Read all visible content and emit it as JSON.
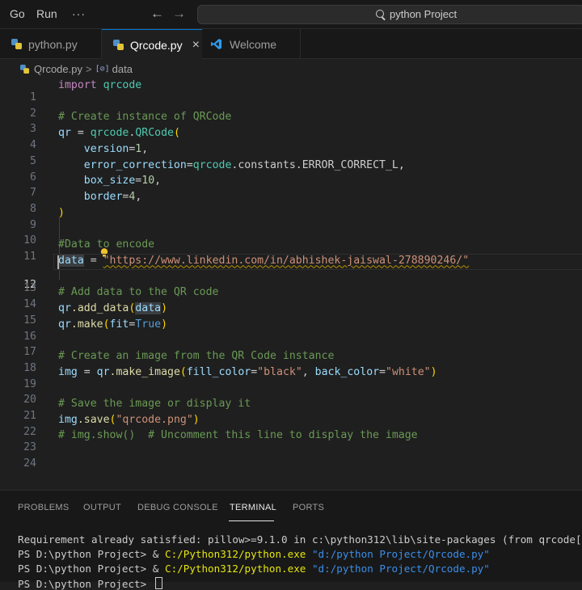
{
  "titlebar": {
    "menu_go": "Go",
    "menu_run": "Run",
    "menu_more": "···",
    "back_icon": "←",
    "forward_icon": "→",
    "search_text": "python Project"
  },
  "tabs": [
    {
      "label": "python.py",
      "icon": "python-file-icon",
      "active": false
    },
    {
      "label": "Qrcode.py",
      "icon": "python-file-icon",
      "active": true,
      "close": "×"
    },
    {
      "label": "Welcome",
      "icon": "vscode-logo-icon",
      "active": false
    }
  ],
  "breadcrumb": {
    "file": "Qrcode.py",
    "separator": ">",
    "symbol_icon": "[⊘]",
    "symbol": "data"
  },
  "editor": {
    "line_numbers": [
      "1",
      "2",
      "3",
      "4",
      "5",
      "6",
      "7",
      "8",
      "9",
      "10",
      "11",
      "12",
      "13",
      "14",
      "15",
      "16",
      "17",
      "18",
      "19",
      "20",
      "21",
      "22",
      "23",
      "24"
    ],
    "active_line": 12,
    "lines": {
      "l1": {
        "kw": "import",
        "mod": "qrcode"
      },
      "l3": {
        "comment": "# Create instance of QRCode"
      },
      "l4": {
        "var": "qr",
        "eq": " = ",
        "mod": "qrcode",
        "dot": ".",
        "cls": "QRCode",
        "open": "("
      },
      "l5": {
        "arg": "version",
        "eq": "=",
        "num": "1",
        "comma": ","
      },
      "l6": {
        "arg": "error_correction",
        "eq": "=",
        "mod": "qrcode",
        "rest": ".constants.ERROR_CORRECT_L,"
      },
      "l7": {
        "arg": "box_size",
        "eq": "=",
        "num": "10",
        "comma": ","
      },
      "l8": {
        "arg": "border",
        "eq": "=",
        "num": "4",
        "comma": ","
      },
      "l9": {
        "close": ")"
      },
      "l11": {
        "comment": "Data to encode",
        "hash": "#"
      },
      "l12": {
        "var": "data",
        "eq": " = ",
        "str": "\"https://www.linkedin.com/in/abhishek-jaiswal-278890246/\""
      },
      "l14": {
        "comment": "# Add data to the QR code"
      },
      "l15": {
        "var": "qr",
        "fn": ".add_data",
        "open": "(",
        "arg": "data",
        "close": ")"
      },
      "l16": {
        "var": "qr",
        "fn": ".make",
        "open": "(",
        "arg": "fit",
        "eq": "=",
        "bool": "True",
        "close": ")"
      },
      "l18": {
        "comment": "# Create an image from the QR Code instance"
      },
      "l19": {
        "var": "img",
        "eq": " = ",
        "var2": "qr",
        "fn": ".make_image",
        "open": "(",
        "arg1": "fill_color",
        "eq2": "=",
        "str1": "\"black\"",
        "comma": ", ",
        "arg2": "back_color",
        "eq3": "=",
        "str2": "\"white\"",
        "close": ")"
      },
      "l21": {
        "comment": "# Save the image or display it"
      },
      "l22": {
        "var": "img",
        "fn": ".save",
        "open": "(",
        "str": "\"qrcode.png\"",
        "close": ")"
      },
      "l23": {
        "comment": "# img.show()  # Uncomment this line to display the image"
      }
    }
  },
  "panel": {
    "tabs": [
      "PROBLEMS",
      "OUTPUT",
      "DEBUG CONSOLE",
      "TERMINAL",
      "PORTS"
    ],
    "active_tab": "TERMINAL",
    "terminal": {
      "line1": "Requirement already satisfied: pillow>=9.1.0 in c:\\python312\\lib\\site-packages (from qrcode[pil]",
      "prompt": "PS D:\\python Project> & ",
      "exe": "C:/Python312/python.exe",
      "arg": "\"d:/python Project/Qrcode.py\"",
      "prompt_last": "PS D:\\python Project> "
    }
  },
  "colors": {
    "editor_bg": "#1f1f1f",
    "chrome_bg": "#181818",
    "keyword": "#c586c0",
    "module": "#4ec9b0",
    "comment": "#6a9955",
    "string": "#ce9178",
    "number": "#b5cea8",
    "accent": "#0078d4"
  }
}
